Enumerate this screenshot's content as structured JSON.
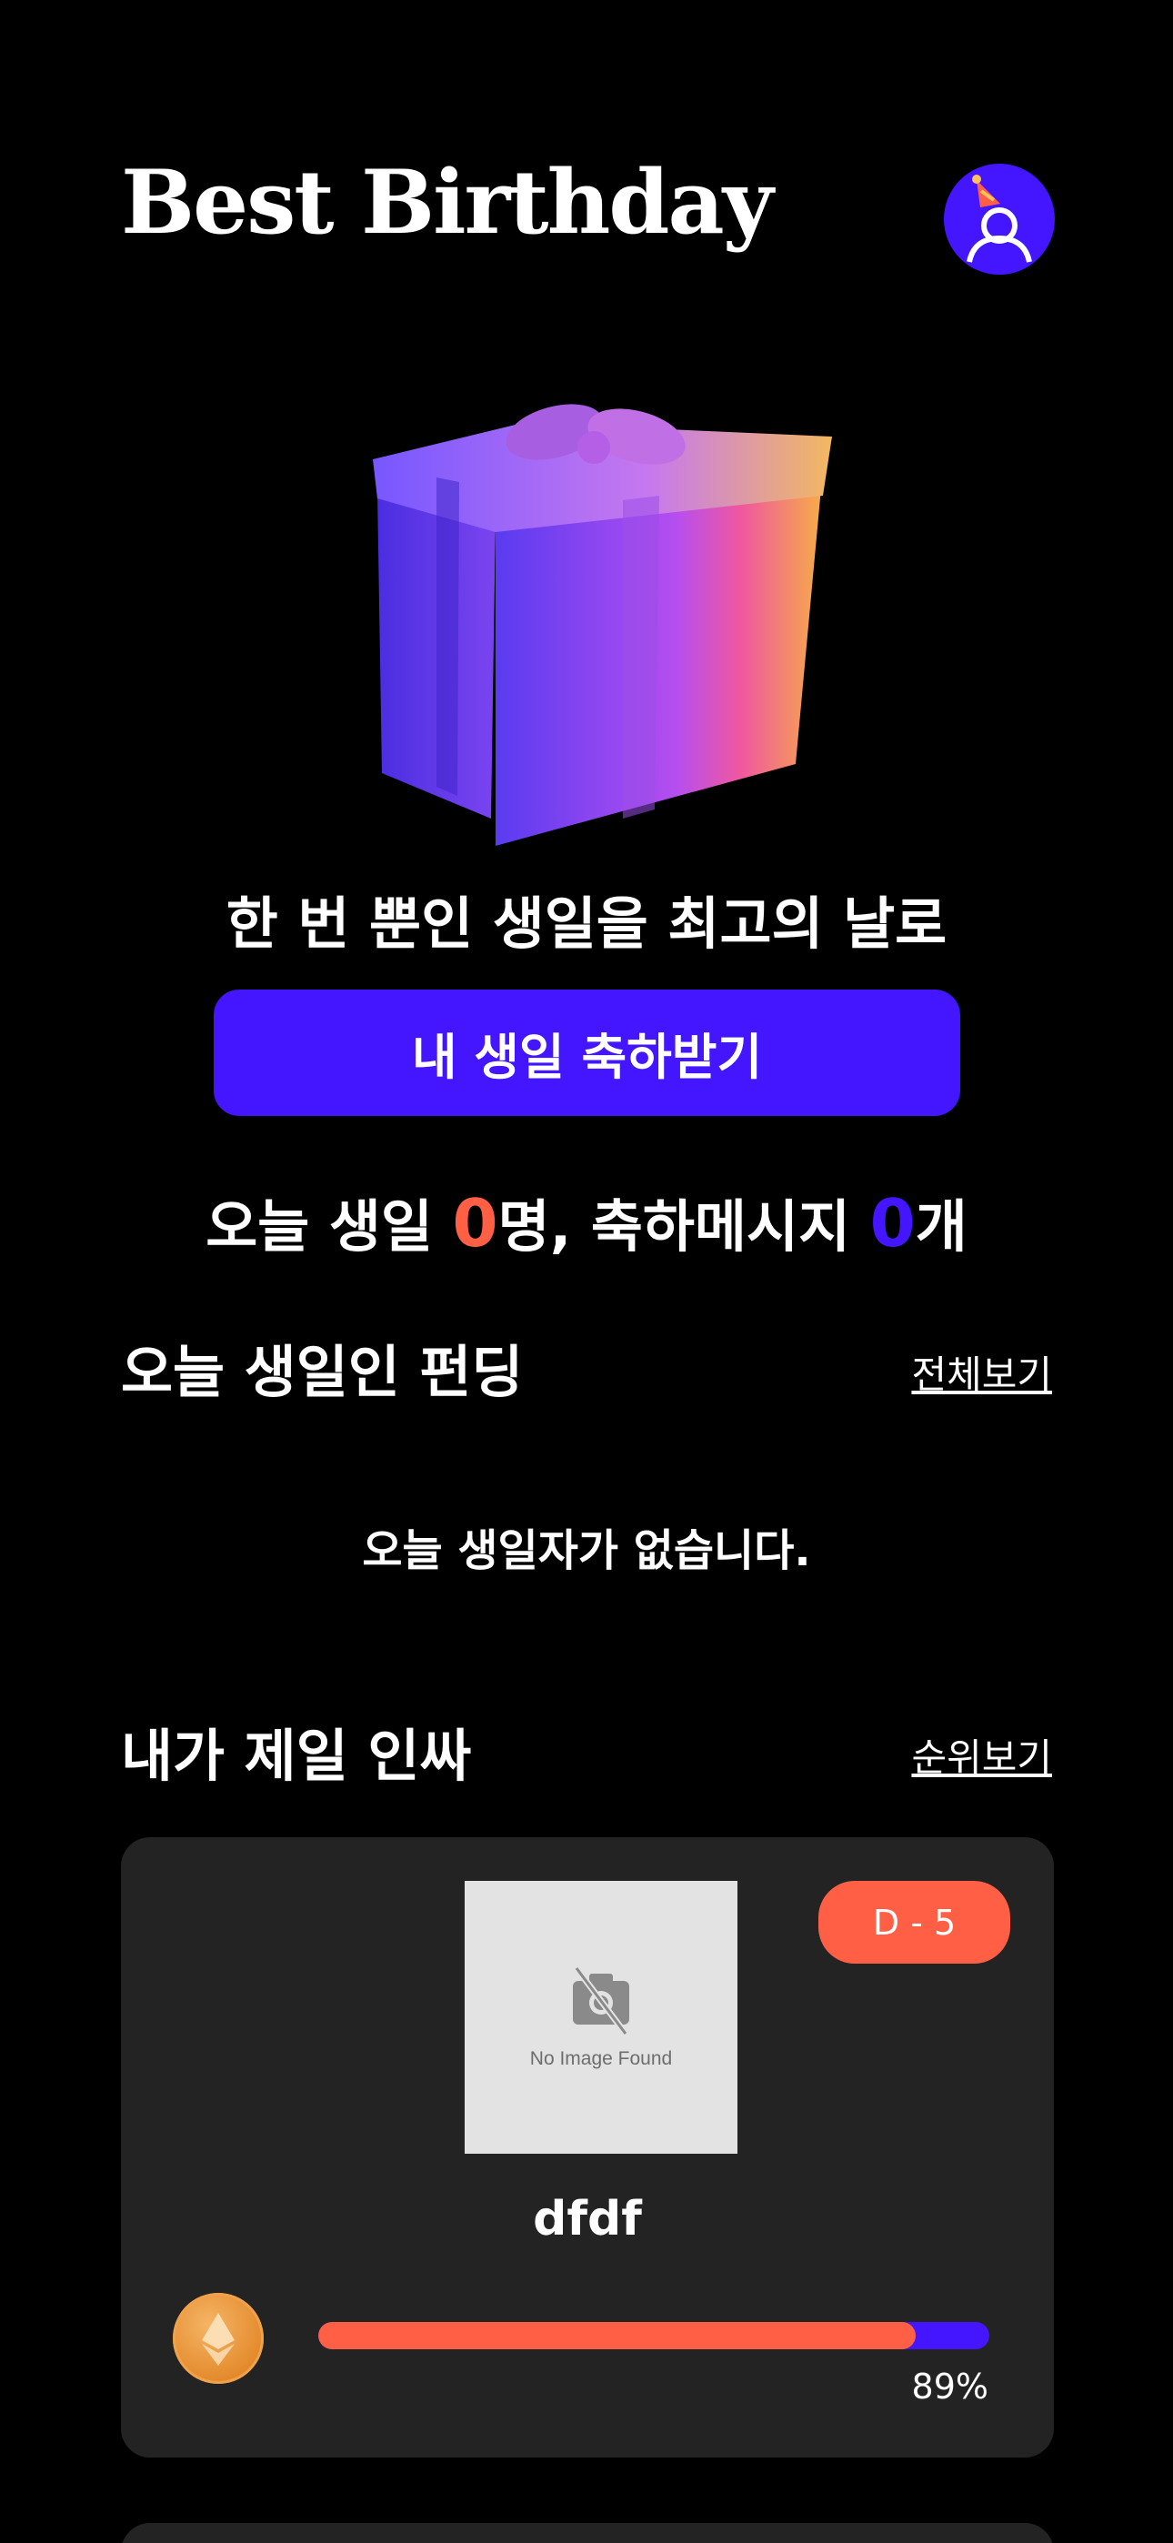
{
  "header": {
    "title": "Best Birthday",
    "avatar_icon": "party-hat-user-icon"
  },
  "hero": {
    "image_icon": "gift-box-icon",
    "tagline": "한 번 뿐인 생일을 최고의 날로",
    "cta_label": "내 생일 축하받기"
  },
  "stats": {
    "prefix": "오늘 생일 ",
    "birthday_count": "0",
    "middle": "명, 축하메시지 ",
    "message_count": "0",
    "suffix": "개"
  },
  "today_funding": {
    "title": "오늘 생일인 펀딩",
    "link": "전체보기",
    "empty_message": "오늘 생일자가 없습니다."
  },
  "ranking": {
    "title": "내가 제일 인싸",
    "link": "순위보기",
    "cards": [
      {
        "image_placeholder": "No Image Found",
        "d_day": "D - 5",
        "name": "dfdf",
        "currency_icon": "ethereum-coin-icon",
        "progress": 0.89,
        "progress_label": "89%"
      }
    ]
  },
  "colors": {
    "accent_purple": "#4316ff",
    "accent_orange": "#ff5f45",
    "card_bg": "#232323",
    "background": "#000000"
  }
}
